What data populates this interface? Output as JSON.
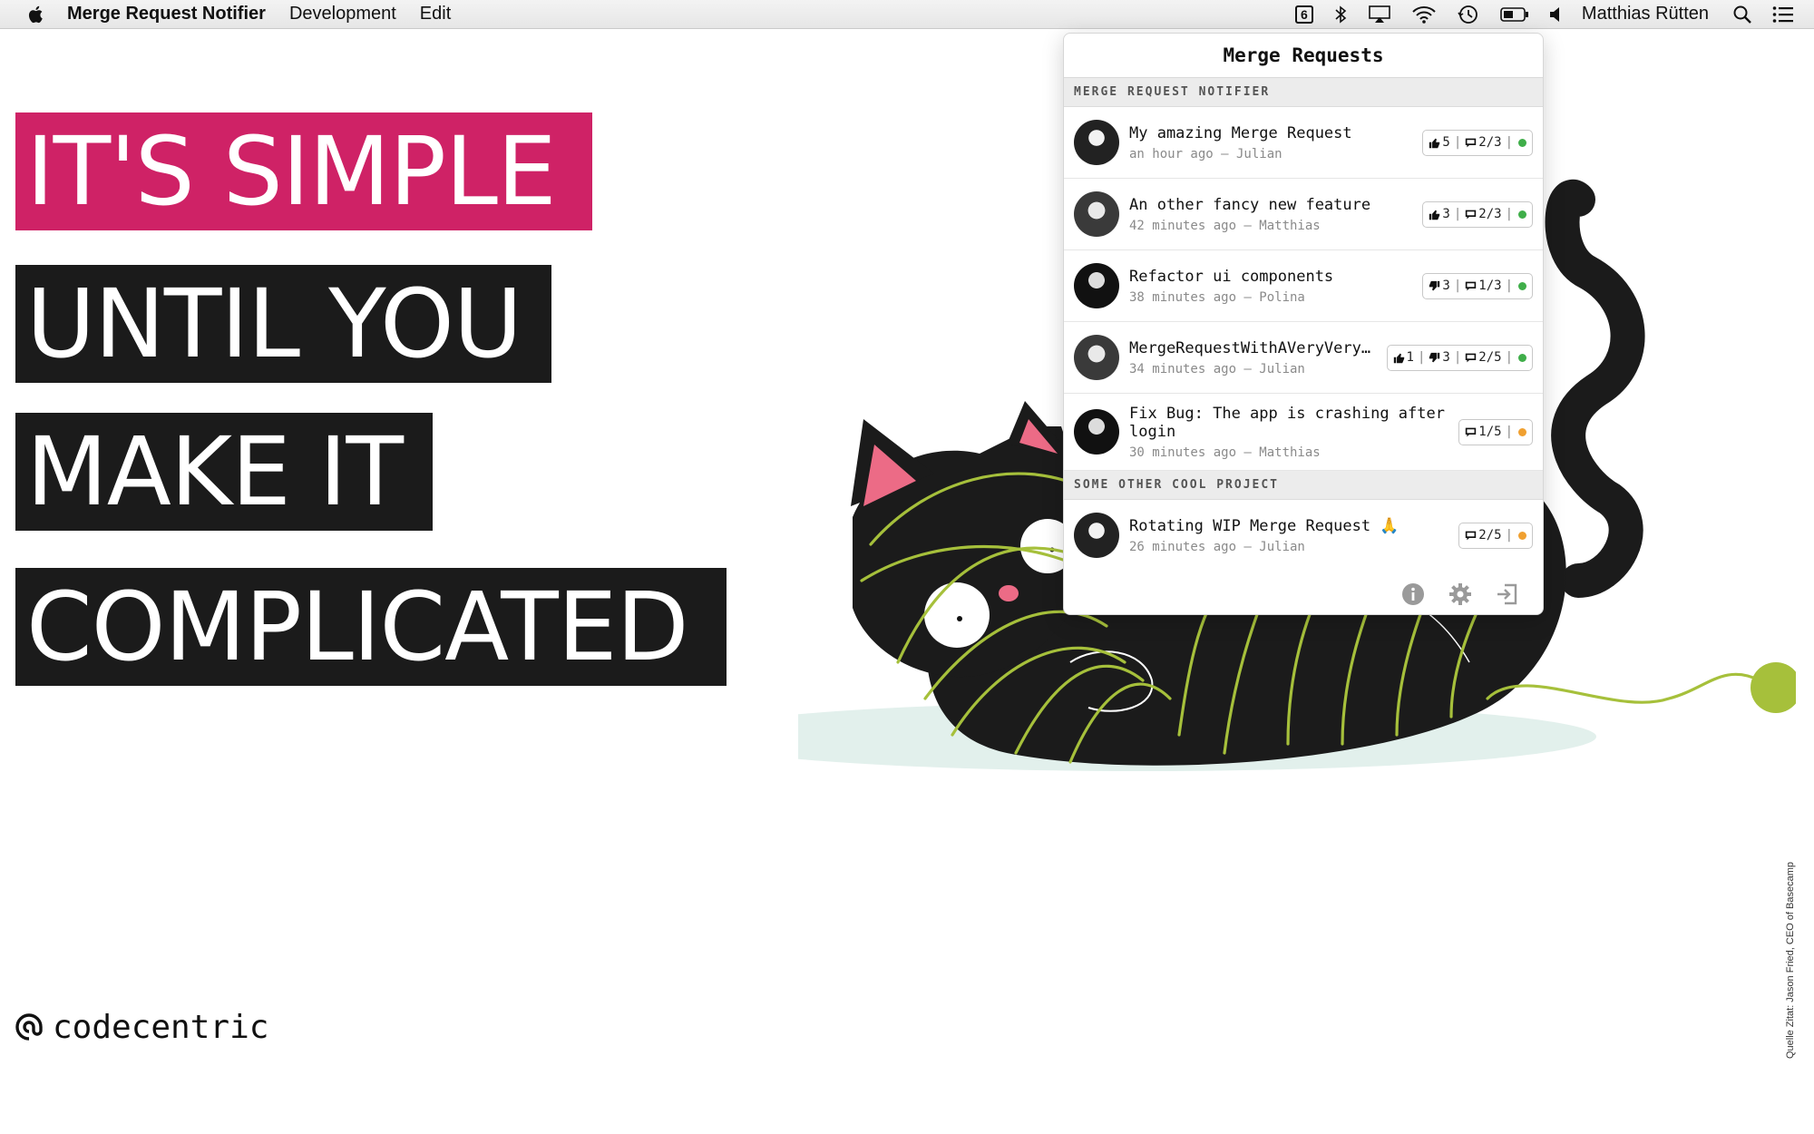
{
  "menubar": {
    "app_name": "Merge Request Notifier",
    "menus": [
      "Development",
      "Edit"
    ],
    "status_badge": "6",
    "user_name": "Matthias Rütten"
  },
  "headline": [
    "IT'S SIMPLE",
    "UNTIL YOU",
    "MAKE IT",
    "COMPLICATED"
  ],
  "logo": {
    "text": "codecentric"
  },
  "source_note": "Quelle Zitat: Jason Fried, CEO of Basecamp",
  "popover": {
    "title": "Merge Requests",
    "sections": [
      {
        "name": "MERGE REQUEST NOTIFIER",
        "items": [
          {
            "title": "My amazing Merge Request",
            "meta": "an hour ago — Julian",
            "up": "5",
            "down": "",
            "comments": "2/3",
            "status": "#3fae49",
            "avatar": "julian"
          },
          {
            "title": "An other fancy new feature",
            "meta": "42 minutes ago — Matthias",
            "up": "3",
            "down": "",
            "comments": "2/3",
            "status": "#3fae49",
            "avatar": "matthias"
          },
          {
            "title": "Refactor ui components",
            "meta": "38 minutes ago — Polina",
            "up": "",
            "down": "3",
            "comments": "1/3",
            "status": "#3fae49",
            "avatar": "polina"
          },
          {
            "title": "MergeRequestWithAVeryVeryVe…",
            "meta": "34 minutes ago — Julian",
            "up": "1",
            "down": "3",
            "comments": "2/5",
            "status": "#3fae49",
            "avatar": "matthias"
          },
          {
            "title": "Fix Bug: The app is crashing after login",
            "meta": "30 minutes ago — Matthias",
            "up": "",
            "down": "",
            "comments": "1/5",
            "status": "#f0a030",
            "avatar": "polina"
          }
        ]
      },
      {
        "name": "SOME OTHER COOL PROJECT",
        "items": [
          {
            "title": "Rotating WIP Merge Request 🙏",
            "meta": "26 minutes ago — Julian",
            "up": "",
            "down": "",
            "comments": "2/5",
            "status": "#f0a030",
            "avatar": "julian"
          }
        ]
      }
    ],
    "footer_icons": [
      "info-icon",
      "settings-icon",
      "logout-icon"
    ]
  },
  "colors": {
    "headline_pink": "#cf2266",
    "headline_black": "#1b1b1b",
    "yarn_green": "#a6c03b",
    "status_green": "#3fae49",
    "status_orange": "#f0a030"
  }
}
